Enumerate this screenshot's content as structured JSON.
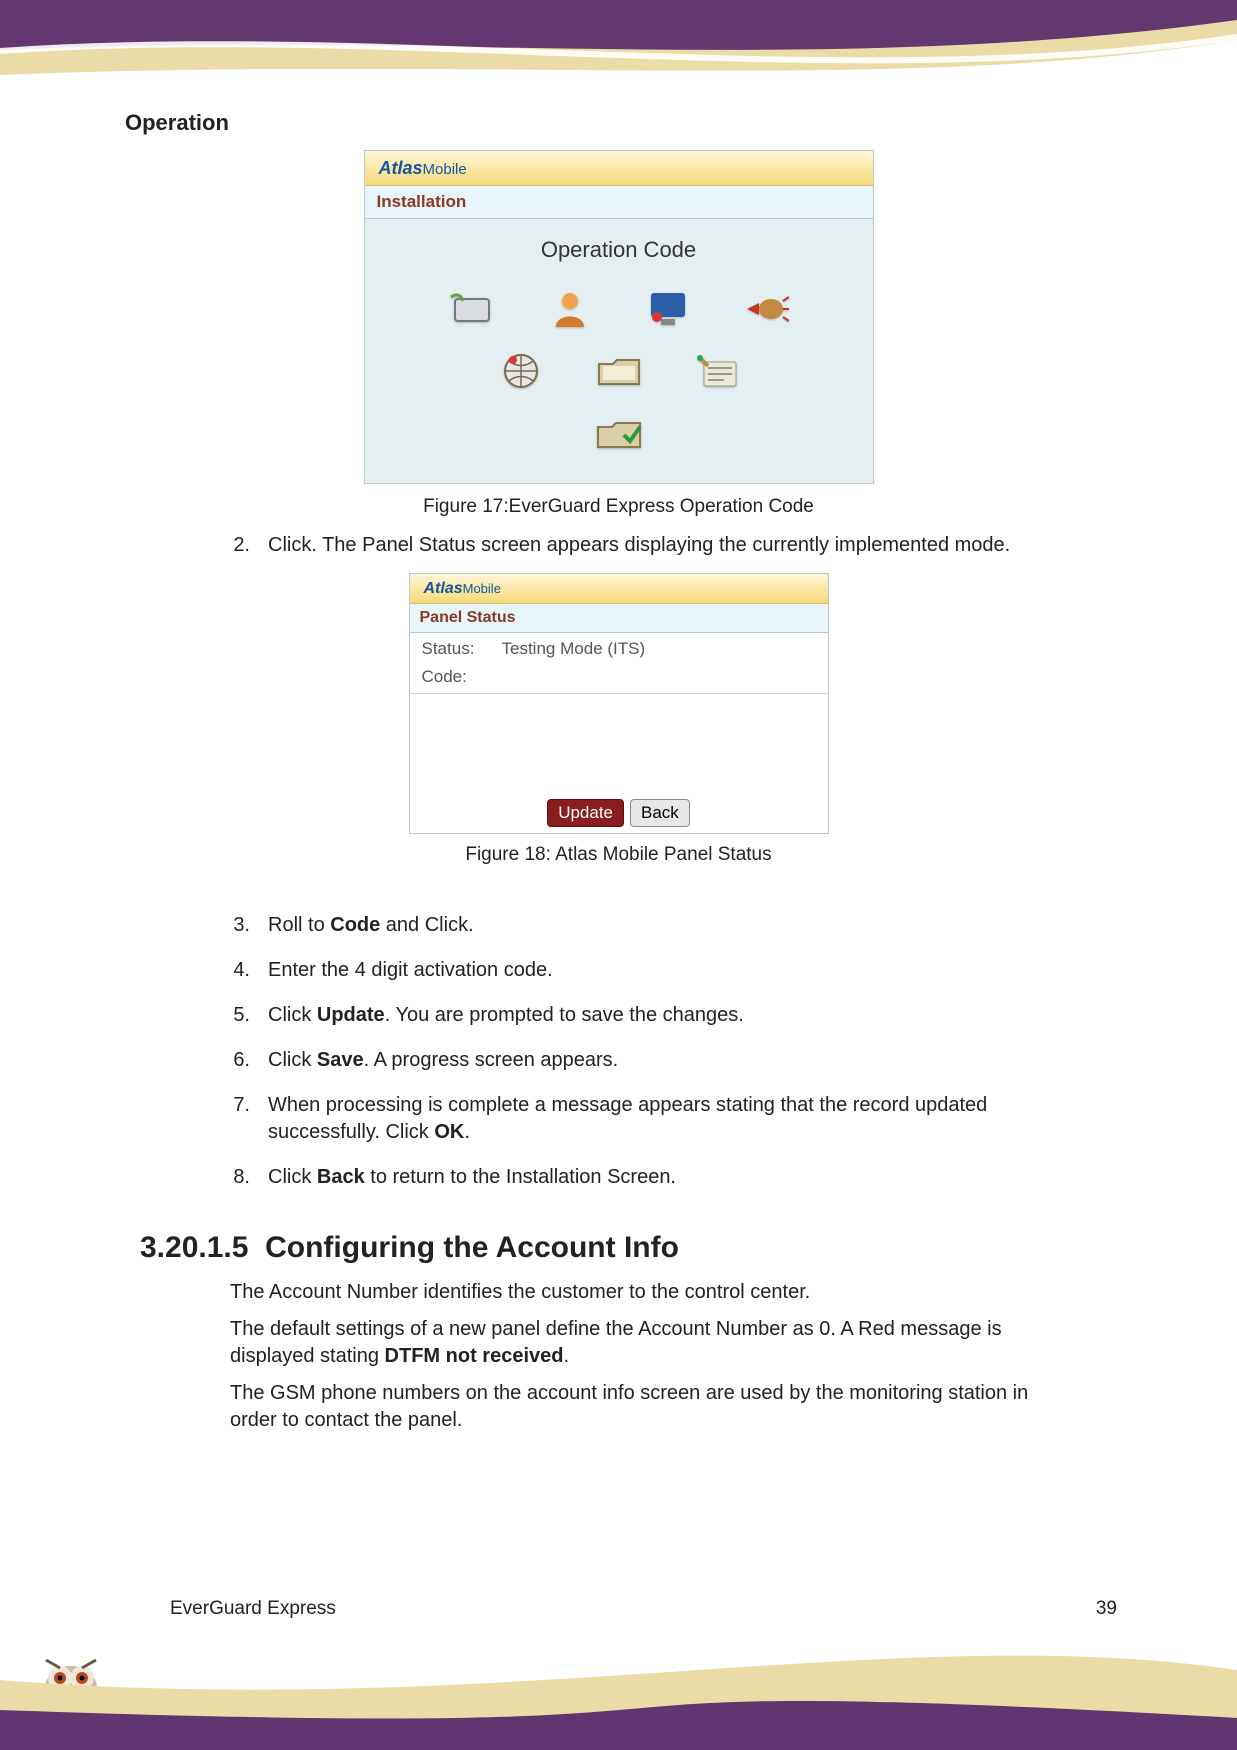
{
  "header": {
    "section_title": "Operation"
  },
  "fig17": {
    "logo_bold": "Atlas",
    "logo_thin": "Mobile",
    "section_label": "Installation",
    "body_title": "Operation Code",
    "caption": "Figure 17:EverGuard Express Operation Code",
    "icons_row1": [
      "panel-icon",
      "user-icon",
      "monitor-icon",
      "siren-icon"
    ],
    "icons_row2": [
      "globe-icon",
      "folder-icon",
      "notes-icon"
    ],
    "icons_row3": [
      "folder-check-icon"
    ]
  },
  "step2": {
    "num": "2.",
    "text": "Click. The Panel Status screen appears displaying the currently implemented mode."
  },
  "fig18": {
    "logo_bold": "Atlas",
    "logo_thin": "Mobile",
    "panel_title": "Panel Status",
    "status_label": "Status:",
    "status_value": "Testing Mode (ITS)",
    "code_label": "Code:",
    "btn_update": "Update",
    "btn_back": "Back",
    "caption": "Figure 18: Atlas Mobile Panel Status"
  },
  "steps_rest": [
    {
      "num": "3.",
      "before": "Roll to ",
      "bold": "Code",
      "after": " and Click."
    },
    {
      "num": "4.",
      "before": "Enter the 4 digit activation code.",
      "bold": "",
      "after": ""
    },
    {
      "num": "5.",
      "before": "Click ",
      "bold": "Update",
      "after": ". You are prompted to save the changes."
    },
    {
      "num": "6.",
      "before": "Click ",
      "bold": "Save",
      "after": ". A progress screen appears."
    },
    {
      "num": "7.",
      "before": "When processing is complete a message appears stating that the record updated successfully. Click ",
      "bold": "OK",
      "after": "."
    },
    {
      "num": "8.",
      "before": "Click ",
      "bold": "Back",
      "after": " to return to the Installation Screen."
    }
  ],
  "heading": {
    "num": "3.20.1.5",
    "title": "Configuring the Account Info"
  },
  "paragraphs": {
    "p1": "The Account Number identifies the customer to the control center.",
    "p2_before": "The default settings of a new panel define the Account Number as 0. A Red message is displayed stating ",
    "p2_bold": "DTFM not received",
    "p2_after": ".",
    "p3": "The GSM phone numbers on the account info screen are used by the monitoring station in order to contact the panel."
  },
  "footer": {
    "product": "EverGuard Express",
    "page": "39"
  }
}
